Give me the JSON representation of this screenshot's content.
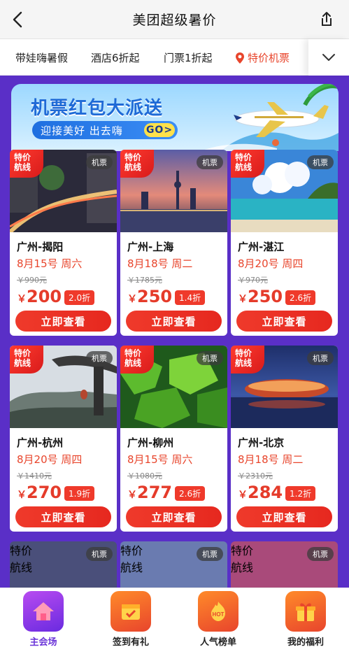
{
  "header": {
    "title": "美团超级暑价"
  },
  "tabs": [
    {
      "label": "带娃嗨暑假"
    },
    {
      "label": "酒店6折起"
    },
    {
      "label": "门票1折起"
    },
    {
      "label": "特价机票",
      "active": true
    }
  ],
  "banner": {
    "title": "机票红包大派送",
    "subtitle": "迎接美好 出去嗨",
    "go": "GO>"
  },
  "card_common": {
    "hot_badge_line1": "特价",
    "hot_badge_line2": "航线",
    "type_badge": "机票",
    "buy_label": "立即查看",
    "currency": "￥"
  },
  "cards": [
    {
      "route": "广州-揭阳",
      "date": "8月15号 周六",
      "orig": "￥990元",
      "price": "200",
      "discount": "2.0折"
    },
    {
      "route": "广州-上海",
      "date": "8月18号 周二",
      "orig": "￥1785元",
      "price": "250",
      "discount": "1.4折"
    },
    {
      "route": "广州-湛江",
      "date": "8月20号 周四",
      "orig": "￥970元",
      "price": "250",
      "discount": "2.6折"
    },
    {
      "route": "广州-杭州",
      "date": "8月20号 周四",
      "orig": "￥1410元",
      "price": "270",
      "discount": "1.9折"
    },
    {
      "route": "广州-柳州",
      "date": "8月15号 周六",
      "orig": "￥1080元",
      "price": "277",
      "discount": "2.6折"
    },
    {
      "route": "广州-北京",
      "date": "8月18号 周二",
      "orig": "￥2310元",
      "price": "284",
      "discount": "1.2折"
    }
  ],
  "bottom_nav": [
    {
      "label": "主会场",
      "active": true
    },
    {
      "label": "签到有礼"
    },
    {
      "label": "人气榜单"
    },
    {
      "label": "我的福利"
    }
  ],
  "colors": {
    "accent": "#e8452c",
    "page_bg": "#5a2fc7",
    "nav_active": "#6a33d8"
  }
}
